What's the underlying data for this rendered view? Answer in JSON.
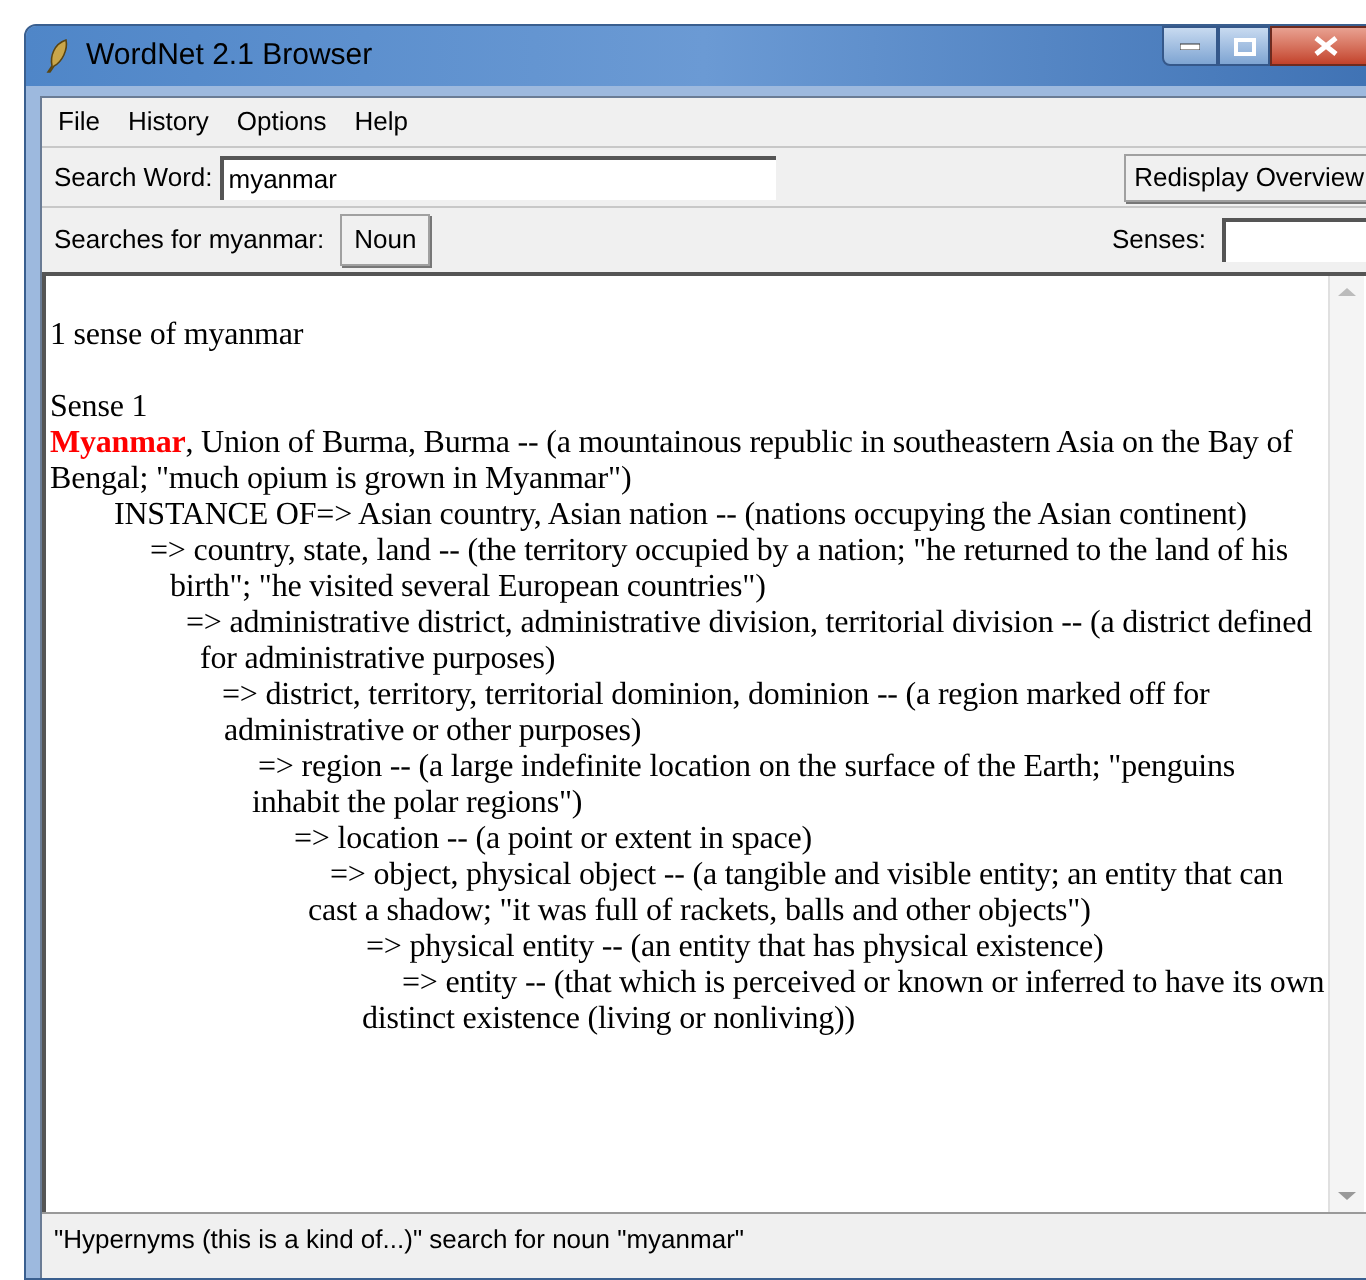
{
  "window": {
    "title": "WordNet 2.1 Browser"
  },
  "menu": [
    "File",
    "History",
    "Options",
    "Help"
  ],
  "search": {
    "label": "Search Word:",
    "value": "myanmar",
    "button": "Redisplay Overview"
  },
  "searches": {
    "label": "Searches for myanmar:",
    "buttons": [
      "Noun"
    ],
    "senses_label": "Senses:"
  },
  "results": {
    "count_line": "1 sense of myanmar",
    "senses": [
      {
        "heading": "Sense 1",
        "definition": "**Myanmar**, Union of Burma, Burma -- (a mountainous republic in southeastern Asia on the Bay of Bengal; \"much opium is grown in Myanmar\")",
        "pointers": [
          {
            "text": "INSTANCE OF=> Asian country, Asian nation -- (nations occupying the Asian continent)",
            "children": [
              {
                "text": "=> country, state, land -- (the territory occupied by a nation; \"he returned to the land of his birth\"; \"he visited several European countries\")",
                "children": [
                  {
                    "text": "=> administrative district, administrative division, territorial division -- (a district defined for administrative purposes)",
                    "children": [
                      {
                        "text": "=> district, territory, territorial dominion, dominion -- (a region marked off for administrative or other purposes)",
                        "children": [
                          {
                            "text": "=> region -- (a large indefinite location on the surface of the Earth; \"penguins inhabit the polar regions\")",
                            "children": [
                              {
                                "text": "=> location -- (a point or extent in space)",
                                "children": [
                                  {
                                    "text": "=> object, physical object -- (a tangible and visible entity; an entity that can cast a shadow; \"it was full of rackets, balls and other objects\")",
                                    "children": [
                                      {
                                        "text": "=> physical entity -- (an entity that has physical existence)",
                                        "children": [
                                          {
                                            "text": "=> entity -- (that which is perceived or known or inferred to have its own distinct existence (living or nonliving))"
                                          }
                                        ]
                                      }
                                    ]
                                  }
                                ]
                              }
                            ]
                          }
                        ]
                      }
                    ]
                  }
                ]
              }
            ]
          }
        ]
      }
    ]
  },
  "status_bar": "\"Hypernyms (this is a kind of...)\" search for noun \"myanmar\""
}
